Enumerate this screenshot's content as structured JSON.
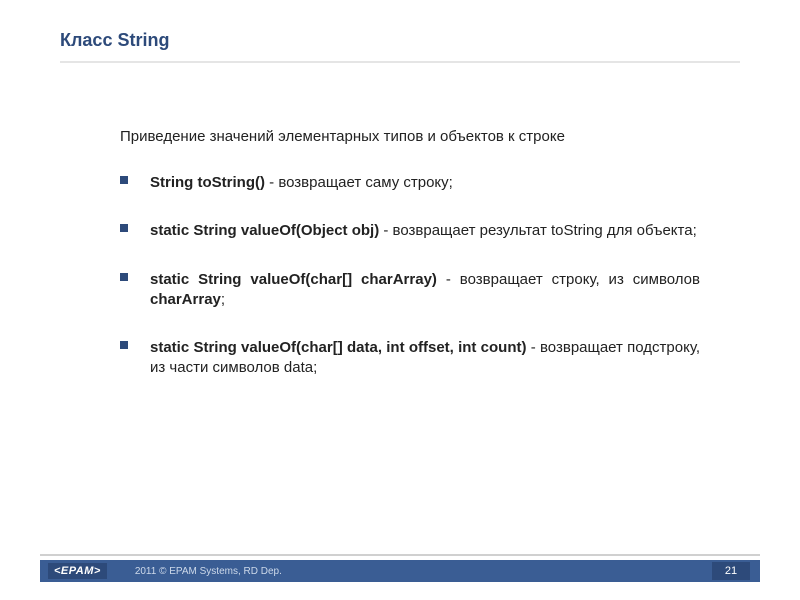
{
  "title": "Класс String",
  "intro": "Приведение значений элементарных типов и объектов к строке",
  "bullets": [
    {
      "bold": "String toString()",
      "rest": " - возвращает саму строку;"
    },
    {
      "bold": "static String valueOf(Object obj)",
      "rest": " - возвращает результат toString для объекта;"
    },
    {
      "bold": "static String valueOf(char[] charArray)",
      "rest": " - возвращает строку, из символов ",
      "bold2": "charArray",
      "rest2": ";"
    },
    {
      "bold": "static String valueOf(char[] data, int offset, int count)",
      "rest": " - возвращает подстроку, из части символов data;"
    }
  ],
  "footer": {
    "logo": "<EPAM>",
    "copyright": "2011 © EPAM Systems, RD Dep.",
    "page": "21"
  }
}
